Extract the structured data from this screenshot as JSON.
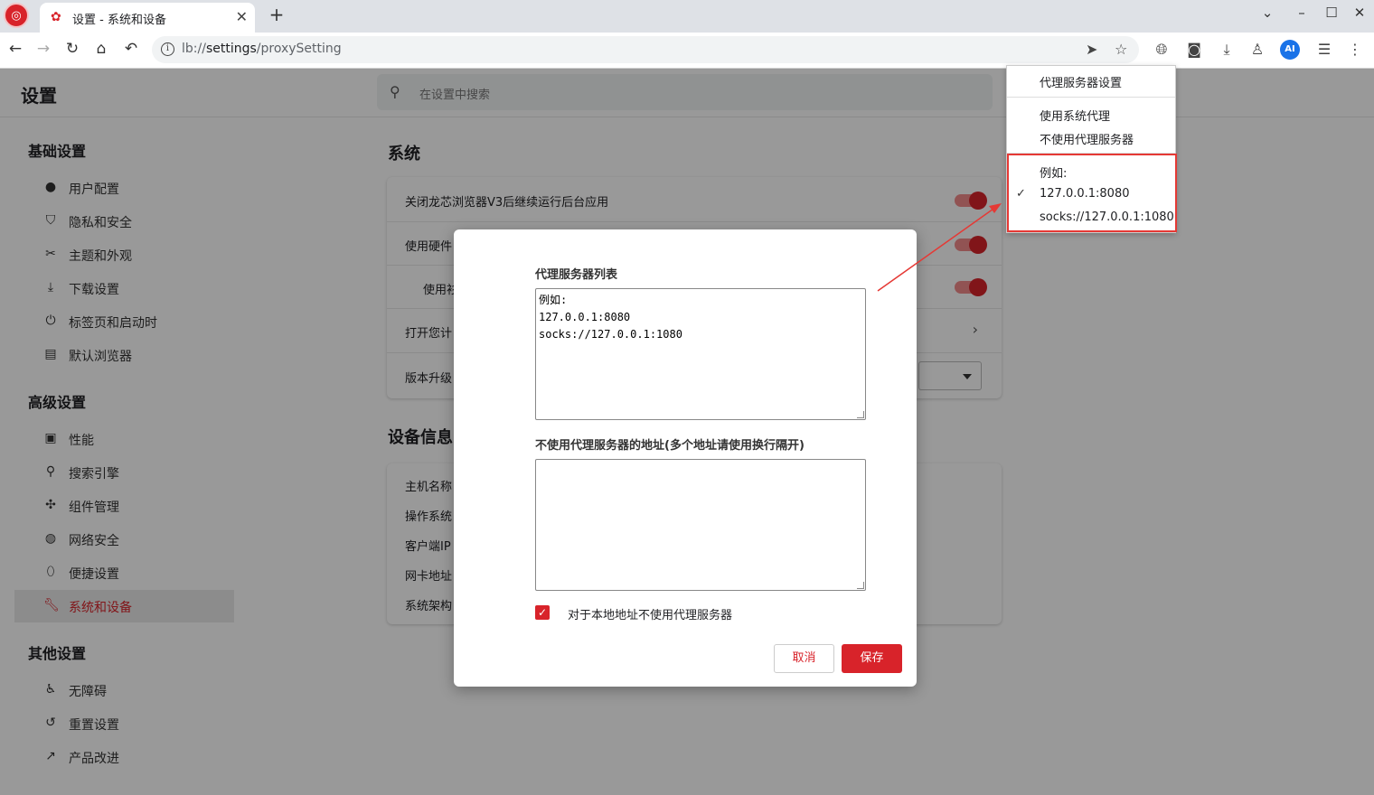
{
  "browser": {
    "tab_title": "设置 - 系统和设备",
    "url_prefix": "lb://",
    "url_host": "settings",
    "url_path": "/proxySetting"
  },
  "page": {
    "title": "设置",
    "search_placeholder": "在设置中搜索"
  },
  "sidebar": {
    "sections": [
      {
        "title": "基础设置",
        "items": [
          {
            "label": "用户配置",
            "icon": "user-icon"
          },
          {
            "label": "隐私和安全",
            "icon": "shield-icon"
          },
          {
            "label": "主题和外观",
            "icon": "palette-icon"
          },
          {
            "label": "下载设置",
            "icon": "download-icon"
          },
          {
            "label": "标签页和启动时",
            "icon": "power-icon"
          },
          {
            "label": "默认浏览器",
            "icon": "browser-icon"
          }
        ]
      },
      {
        "title": "高级设置",
        "items": [
          {
            "label": "性能",
            "icon": "performance-icon"
          },
          {
            "label": "搜索引擎",
            "icon": "search-icon"
          },
          {
            "label": "组件管理",
            "icon": "puzzle-icon"
          },
          {
            "label": "网络安全",
            "icon": "globe-icon"
          },
          {
            "label": "便捷设置",
            "icon": "mouse-icon"
          },
          {
            "label": "系统和设备",
            "icon": "wrench-icon",
            "active": true
          }
        ]
      },
      {
        "title": "其他设置",
        "items": [
          {
            "label": "无障碍",
            "icon": "accessibility-icon"
          },
          {
            "label": "重置设置",
            "icon": "reset-icon"
          },
          {
            "label": "产品改进",
            "icon": "trend-icon"
          }
        ]
      }
    ]
  },
  "main": {
    "system_title": "系统",
    "system_rows": [
      {
        "label": "关闭龙芯浏览器V3后继续运行后台应用",
        "control": "toggle",
        "on": true
      },
      {
        "label": "使用硬件",
        "control": "toggle",
        "on": true
      },
      {
        "label": "使用衫",
        "control": "toggle",
        "on": true
      },
      {
        "label": "打开您计",
        "control": "chevron"
      },
      {
        "label": "版本升级",
        "control": "select"
      }
    ],
    "device_title": "设备信息",
    "device_rows": [
      {
        "label": "主机名称"
      },
      {
        "label": "操作系统"
      },
      {
        "label": "客户端IP"
      },
      {
        "label": "网卡地址"
      },
      {
        "label": "系统架构"
      }
    ]
  },
  "dialog": {
    "proxy_list_label": "代理服务器列表",
    "proxy_list_value": "例如:\n127.0.0.1:8080\nsocks://127.0.0.1:1080",
    "bypass_label": "不使用代理服务器的地址(多个地址请使用换行隔开)",
    "bypass_value": "",
    "local_bypass_label": "对于本地地址不使用代理服务器",
    "local_bypass_checked": true,
    "cancel_label": "取消",
    "save_label": "保存"
  },
  "proxy_menu": {
    "header": "代理服务器设置",
    "options": [
      "使用系统代理",
      "不使用代理服务器"
    ],
    "list_items": [
      {
        "label": "例如:",
        "checked": false
      },
      {
        "label": "127.0.0.1:8080",
        "checked": true
      },
      {
        "label": "socks://127.0.0.1:1080",
        "checked": false
      }
    ]
  },
  "colors": {
    "accent": "#d8232a",
    "annotation": "#e53935"
  }
}
